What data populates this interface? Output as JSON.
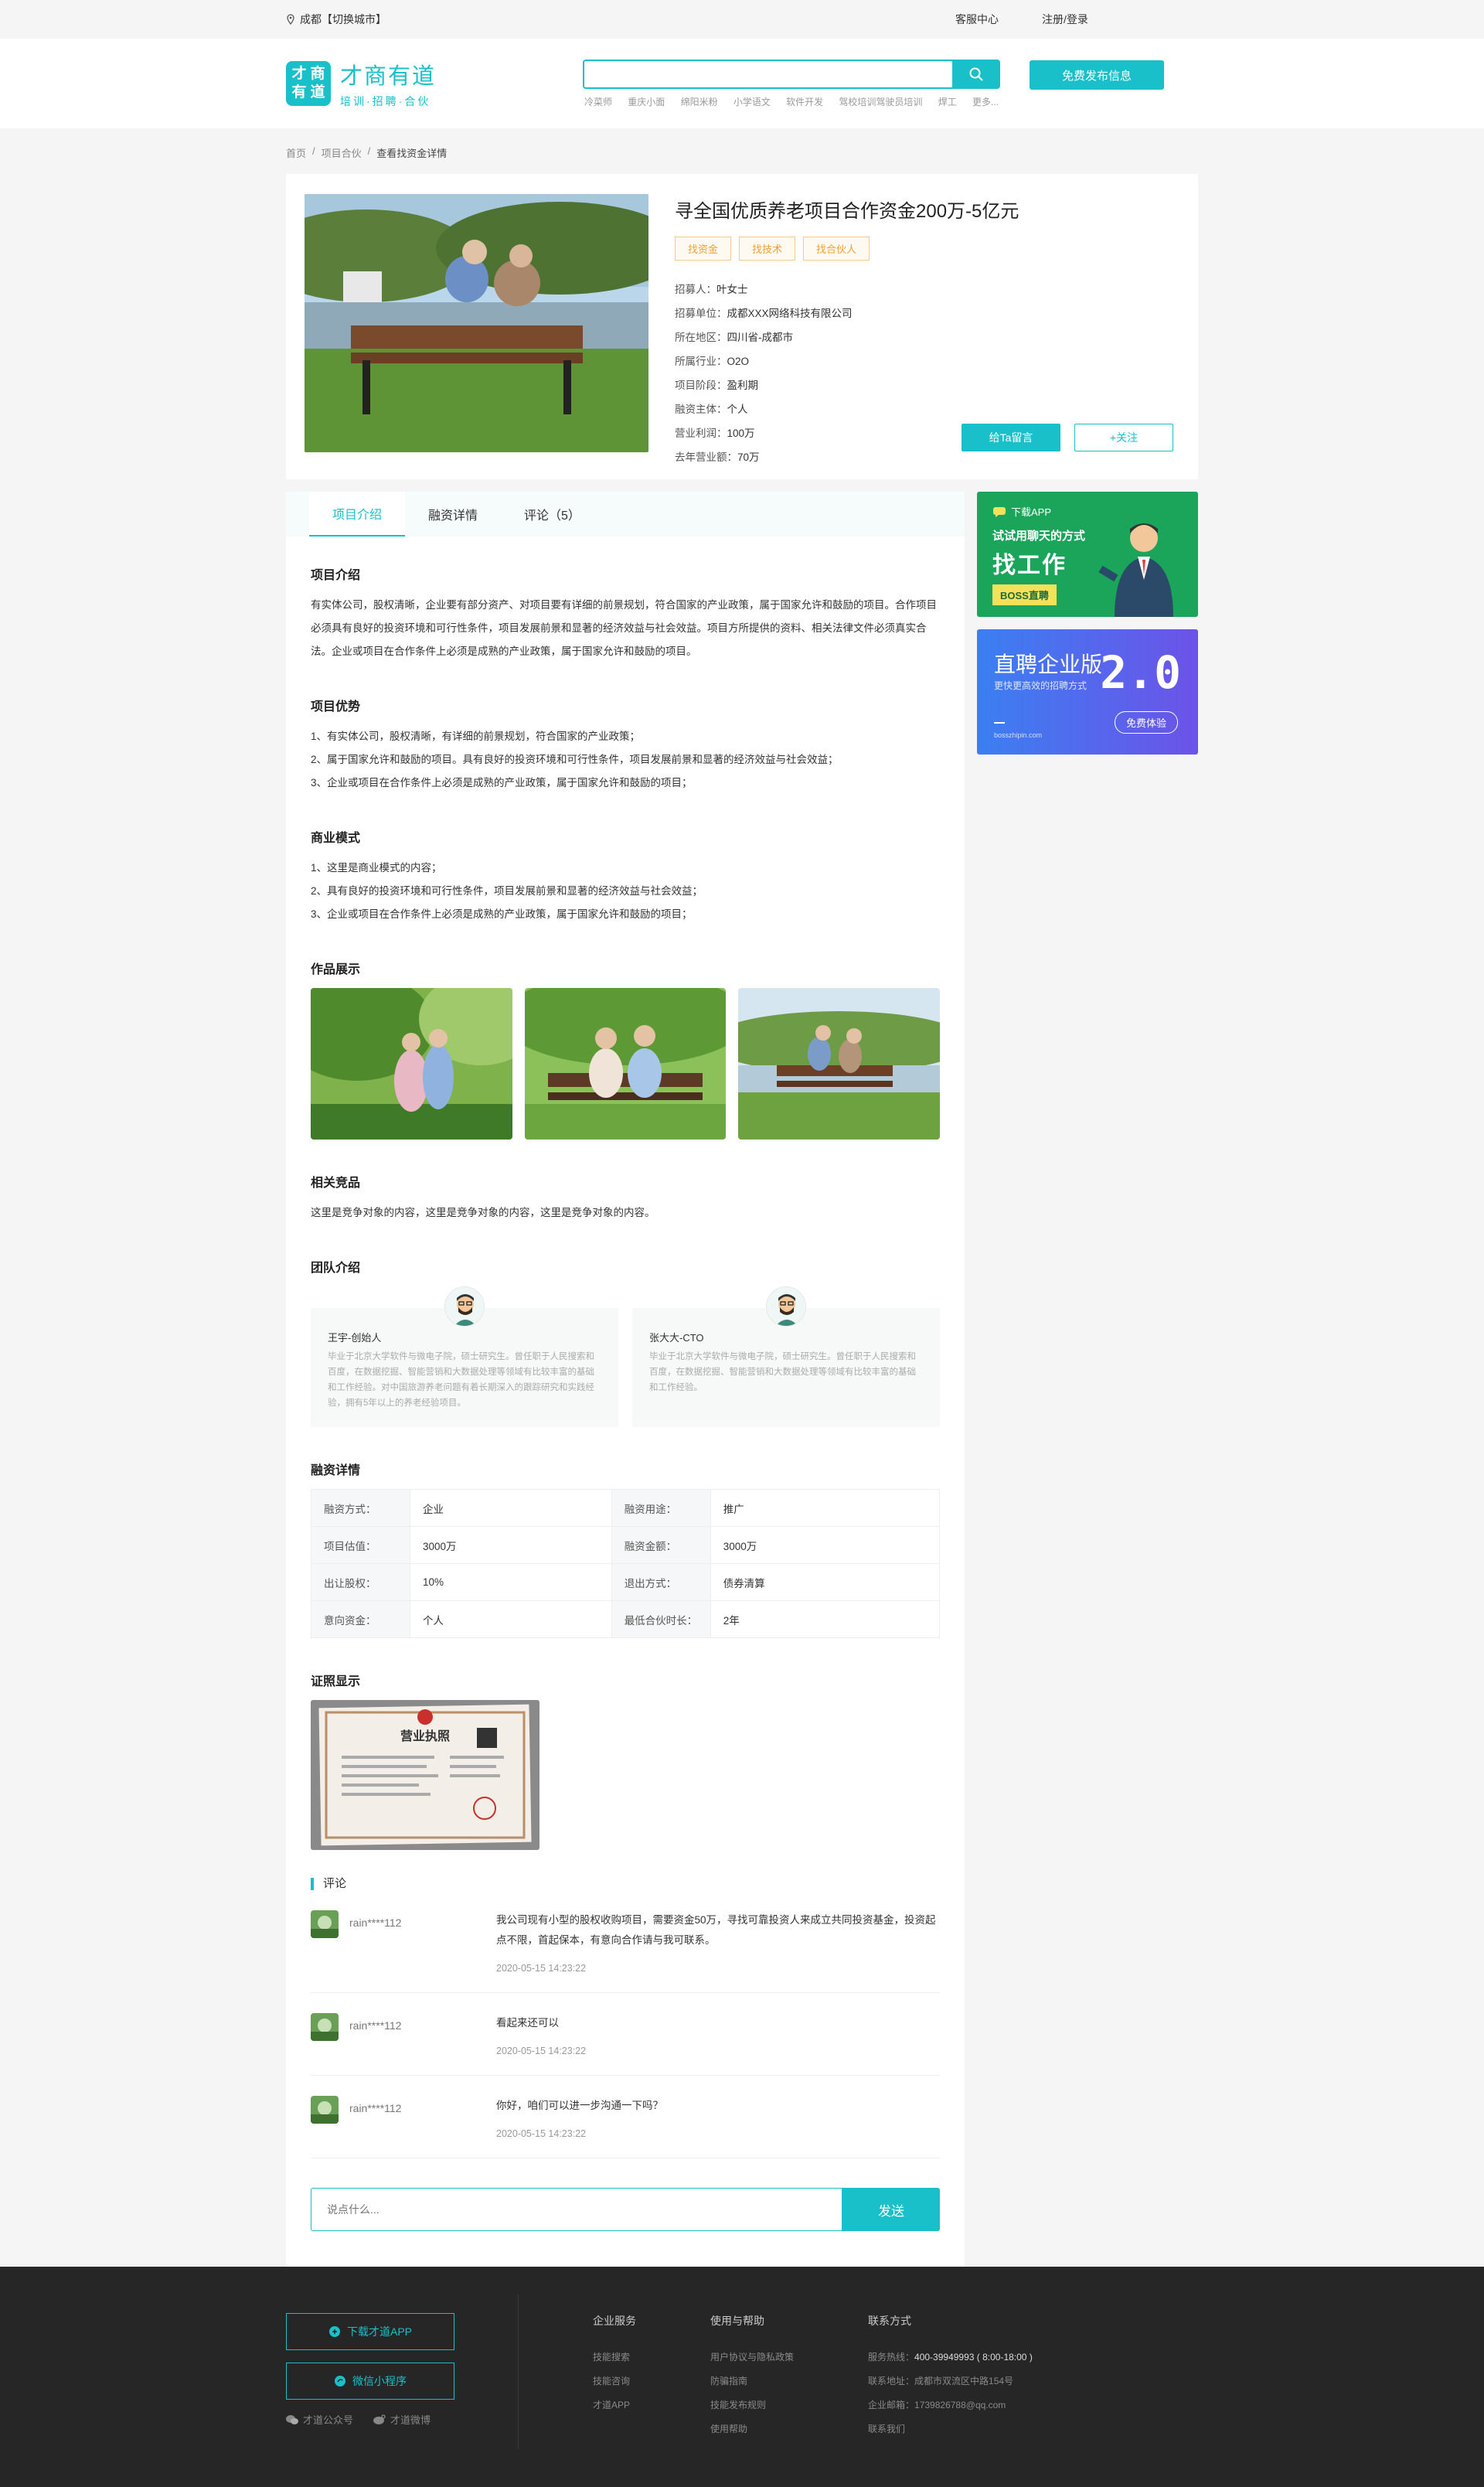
{
  "topbar": {
    "city": "成都【切换城市】",
    "service": "客服中心",
    "login": "注册/登录"
  },
  "header": {
    "logo_chars": [
      "才",
      "商",
      "有",
      "道"
    ],
    "logo_title": "才商有道",
    "logo_slogan": "培训·招聘·合伙",
    "search_placeholder": "",
    "hot_words": [
      "冷菜师",
      "重庆小面",
      "绵阳米粉",
      "小学语文",
      "软件开发",
      "驾校培训驾驶员培训",
      "焊工",
      "更多..."
    ],
    "publish_label": "免费发布信息"
  },
  "breadcrumb": [
    "首页",
    "项目合伙",
    "查看找资金详情"
  ],
  "project": {
    "title": "寻全国优质养老项目合作资金200万-5亿元",
    "tags": [
      "找资金",
      "找技术",
      "找合伙人"
    ],
    "meta": [
      {
        "k": "招募人：",
        "v": "叶女士"
      },
      {
        "k": "招募单位：",
        "v": "成都XXX网络科技有限公司"
      },
      {
        "k": "所在地区：",
        "v": "四川省-成都市"
      },
      {
        "k": "所属行业：",
        "v": "O2O"
      },
      {
        "k": "项目阶段：",
        "v": "盈利期"
      },
      {
        "k": "融资主体：",
        "v": "个人"
      },
      {
        "k": "营业利润：",
        "v": "100万"
      },
      {
        "k": "去年营业额：",
        "v": "70万"
      }
    ],
    "btn_message": "给Ta留言",
    "btn_follow": "+关注"
  },
  "tabs": [
    "项目介绍",
    "融资详情",
    "评论（5）"
  ],
  "intro": {
    "title": "项目介绍",
    "text": "有实体公司，股权清晰，企业要有部分资产、对项目要有详细的前景规划，符合国家的产业政策，属于国家允许和鼓励的项目。合作项目必须具有良好的投资环境和可行性条件，项目发展前景和显著的经济效益与社会效益。项目方所提供的资料、相关法律文件必须真实合法。企业或项目在合作条件上必须是成熟的产业政策，属于国家允许和鼓励的项目。"
  },
  "advantages": {
    "title": "项目优势",
    "items": [
      "1、有实体公司，股权清晰，有详细的前景规划，符合国家的产业政策；",
      "2、属于国家允许和鼓励的项目。具有良好的投资环境和可行性条件，项目发展前景和显著的经济效益与社会效益；",
      "3、企业或项目在合作条件上必须是成熟的产业政策，属于国家允许和鼓励的项目；"
    ]
  },
  "model": {
    "title": "商业模式",
    "items": [
      "1、这里是商业模式的内容；",
      "2、具有良好的投资环境和可行性条件，项目发展前景和显著的经济效益与社会效益；",
      "3、企业或项目在合作条件上必须是成熟的产业政策，属于国家允许和鼓励的项目；"
    ]
  },
  "works": {
    "title": "作品展示"
  },
  "competitors": {
    "title": "相关竞品",
    "text": "这里是竞争对象的内容，这里是竞争对象的内容，这里是竞争对象的内容。"
  },
  "team": {
    "title": "团队介绍",
    "members": [
      {
        "name": "王宇-创始人",
        "desc": "毕业于北京大学软件与微电子院，硕士研究生。曾任职于人民搜索和百度，在数据挖掘、智能营销和大数据处理等领域有比较丰富的基础和工作经验。对中国旅游养老问题有着长期深入的跟踪研究和实践经验，拥有5年以上的养老经验项目。"
      },
      {
        "name": "张大大-CTO",
        "desc": "毕业于北京大学软件与微电子院，硕士研究生。曾任职于人民搜索和百度，在数据挖掘、智能营销和大数据处理等领域有比较丰富的基础和工作经验。"
      }
    ]
  },
  "finance": {
    "title": "融资详情",
    "rows": [
      [
        {
          "k": "融资方式：",
          "v": "企业"
        },
        {
          "k": "融资用途：",
          "v": "推广"
        }
      ],
      [
        {
          "k": "项目估值：",
          "v": "3000万"
        },
        {
          "k": "融资金额：",
          "v": "3000万"
        }
      ],
      [
        {
          "k": "出让股权：",
          "v": "10%"
        },
        {
          "k": "退出方式：",
          "v": "债券清算"
        }
      ],
      [
        {
          "k": "意向资金：",
          "v": "个人"
        },
        {
          "k": "最低合伙时长：",
          "v": "2年"
        }
      ]
    ]
  },
  "license": {
    "title": "证照显示",
    "caption": "营业执照"
  },
  "comments": {
    "title": "评论",
    "items": [
      {
        "user": "rain****112",
        "text": "我公司现有小型的股权收购项目，需要资金50万，寻找可靠投资人来成立共同投资基金，投资起点不限，首起保本，有意向合作请与我可联系。",
        "time": "2020-05-15   14:23:22"
      },
      {
        "user": "rain****112",
        "text": "看起来还可以",
        "time": "2020-05-15   14:23:22"
      },
      {
        "user": "rain****112",
        "text": "你好，咱们可以进一步沟通一下吗？",
        "time": "2020-05-15   14:23:22"
      }
    ],
    "input_placeholder": "说点什么...",
    "send_label": "发送"
  },
  "ads": {
    "ad1": {
      "tag": "下载APP",
      "line1": "试试用聊天的方式",
      "line2": "找工作",
      "brand": "BOSS直聘"
    },
    "ad2": {
      "line1": "直聘企业版",
      "line2": "更快更高效的招聘方式",
      "version": "2.0",
      "btn": "免费体验",
      "url": "bosszhipin.com"
    }
  },
  "footer": {
    "btn_app": "下载才道APP",
    "btn_mini": "微信小程序",
    "social": [
      "才道公众号",
      "才道微博"
    ],
    "cols": [
      {
        "title": "企业服务",
        "items": [
          "技能搜索",
          "技能咨询",
          "才道APP"
        ]
      },
      {
        "title": "使用与帮助",
        "items": [
          "用户协议与隐私政策",
          "防骗指南",
          "技能发布规则",
          "使用帮助"
        ]
      },
      {
        "title": "联系方式",
        "items": [
          {
            "k": "服务热线：",
            "v": "400-39949993  ( 8:00-18:00 )"
          },
          {
            "k": "联系地址：",
            "v": "成都市双流区中路154号"
          },
          {
            "k": "企业邮箱：",
            "v": "1739826788@qq.com"
          },
          {
            "k": "",
            "v": "联系我们"
          }
        ]
      }
    ]
  },
  "colors": {
    "accent": "#19c0c9",
    "tag": "#f0a030",
    "footer": "#262627"
  }
}
